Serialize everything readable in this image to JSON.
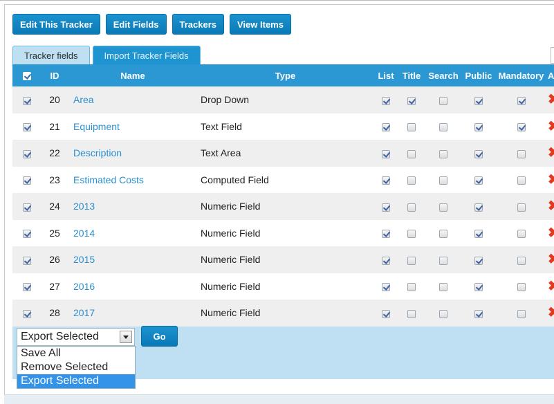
{
  "toolbar": {
    "buttons": [
      "Edit This Tracker",
      "Edit Fields",
      "Trackers",
      "View Items"
    ]
  },
  "tabs": [
    {
      "label": "Tracker fields",
      "active": true
    },
    {
      "label": "Import Tracker Fields",
      "active": false
    }
  ],
  "table": {
    "select_all_checked": true,
    "headers": {
      "id": "ID",
      "name": "Name",
      "type": "Type",
      "list": "List",
      "title": "Title",
      "search": "Search",
      "public": "Public",
      "mandatory": "Mandatory",
      "actions": "A"
    },
    "rows": [
      {
        "selected": true,
        "id": "20",
        "name": "Area",
        "type": "Drop Down",
        "list": true,
        "title": true,
        "search": false,
        "public": true,
        "mandatory": true
      },
      {
        "selected": true,
        "id": "21",
        "name": "Equipment",
        "type": "Text Field",
        "list": true,
        "title": false,
        "search": false,
        "public": true,
        "mandatory": true
      },
      {
        "selected": true,
        "id": "22",
        "name": "Description",
        "type": "Text Area",
        "list": true,
        "title": false,
        "search": false,
        "public": true,
        "mandatory": false
      },
      {
        "selected": true,
        "id": "23",
        "name": "Estimated Costs",
        "type": "Computed Field",
        "list": true,
        "title": false,
        "search": false,
        "public": true,
        "mandatory": false
      },
      {
        "selected": true,
        "id": "24",
        "name": "2013",
        "type": "Numeric Field",
        "list": true,
        "title": false,
        "search": false,
        "public": true,
        "mandatory": false
      },
      {
        "selected": true,
        "id": "25",
        "name": "2014",
        "type": "Numeric Field",
        "list": true,
        "title": false,
        "search": false,
        "public": true,
        "mandatory": false
      },
      {
        "selected": true,
        "id": "26",
        "name": "2015",
        "type": "Numeric Field",
        "list": true,
        "title": false,
        "search": false,
        "public": true,
        "mandatory": false
      },
      {
        "selected": true,
        "id": "27",
        "name": "2016",
        "type": "Numeric Field",
        "list": true,
        "title": false,
        "search": false,
        "public": true,
        "mandatory": false
      },
      {
        "selected": true,
        "id": "28",
        "name": "2017",
        "type": "Numeric Field",
        "list": true,
        "title": false,
        "search": false,
        "public": true,
        "mandatory": false
      }
    ],
    "delete_icon": "delete-x-icon",
    "delete_color": "#e23a20"
  },
  "bulk_action": {
    "selected_value": "Export Selected",
    "go_label": "Go",
    "options": [
      {
        "label": "Save All",
        "highlighted": false
      },
      {
        "label": "Remove Selected",
        "highlighted": false
      },
      {
        "label": "Export Selected",
        "highlighted": true
      }
    ]
  },
  "colors": {
    "accent": "#0a79b6",
    "header_bg": "#2b98d3",
    "panel_bg": "#bfe0f2",
    "link": "#2a8fcf"
  }
}
